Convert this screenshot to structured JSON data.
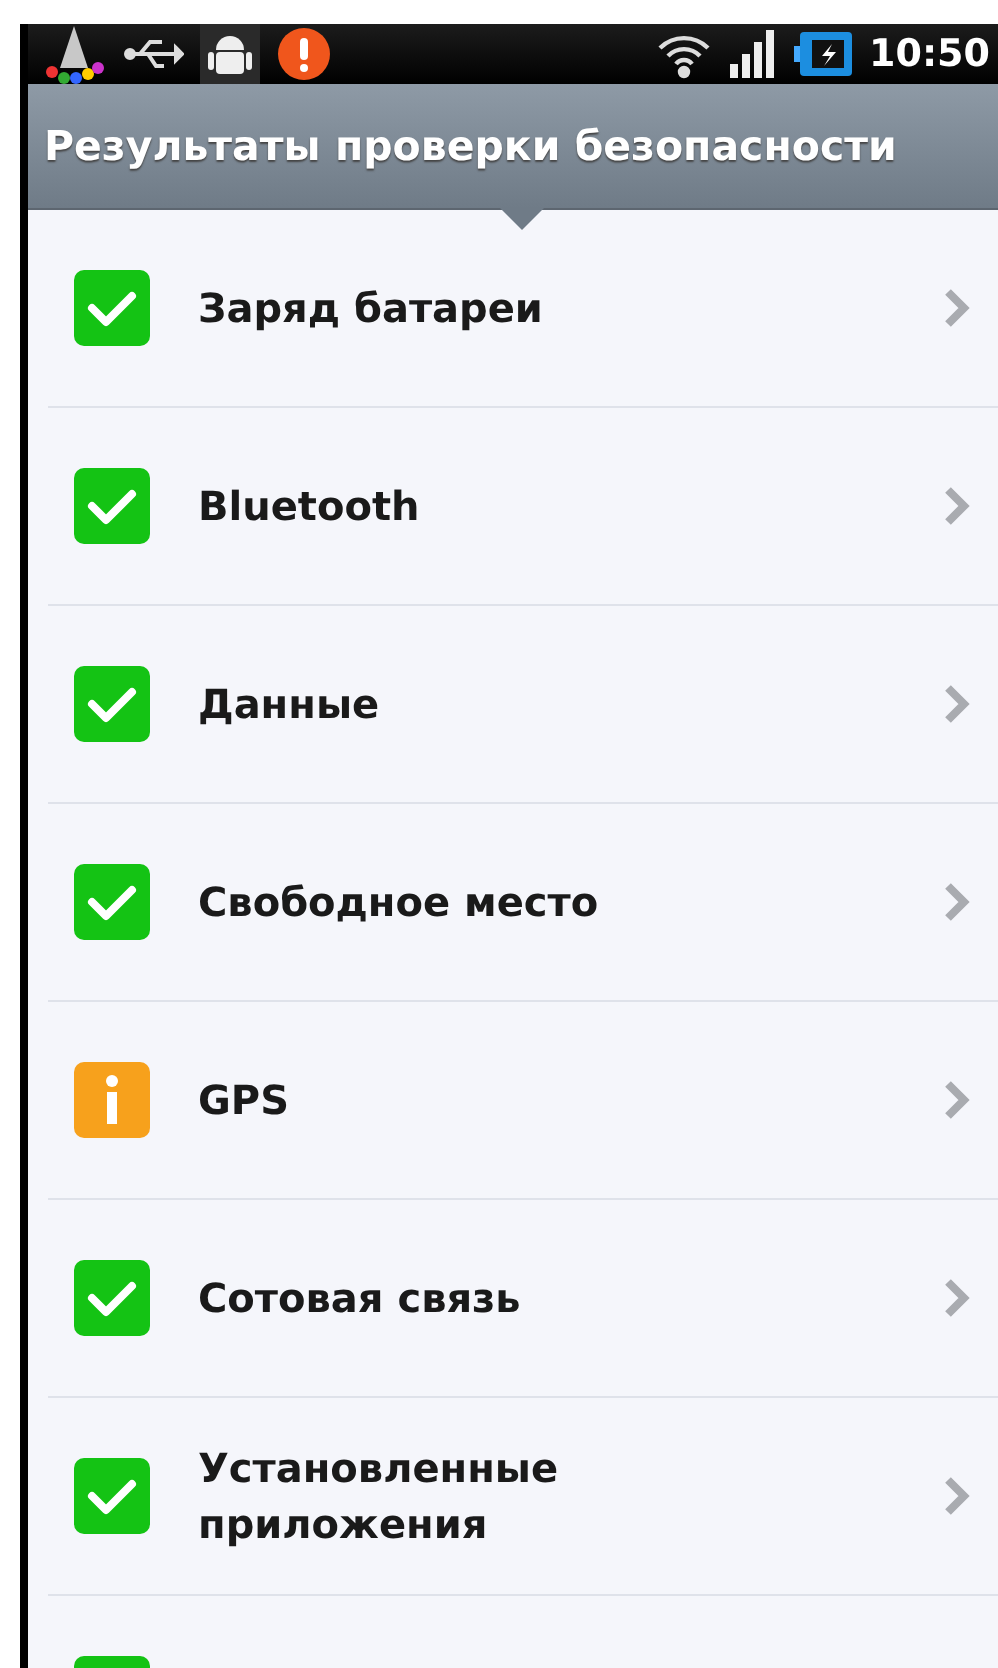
{
  "status_bar": {
    "time": "10:50"
  },
  "title_bar": {
    "title": "Результаты проверки безопасности"
  },
  "results": [
    {
      "label": "Заряд батареи",
      "kind": "ok"
    },
    {
      "label": "Bluetooth",
      "kind": "ok"
    },
    {
      "label": "Данные",
      "kind": "ok"
    },
    {
      "label": "Свободное место",
      "kind": "ok"
    },
    {
      "label": "GPS",
      "kind": "warning"
    },
    {
      "label": "Сотовая связь",
      "kind": "ok"
    },
    {
      "label": "Установленные приложения",
      "kind": "ok"
    },
    {
      "kind": "ok"
    }
  ]
}
